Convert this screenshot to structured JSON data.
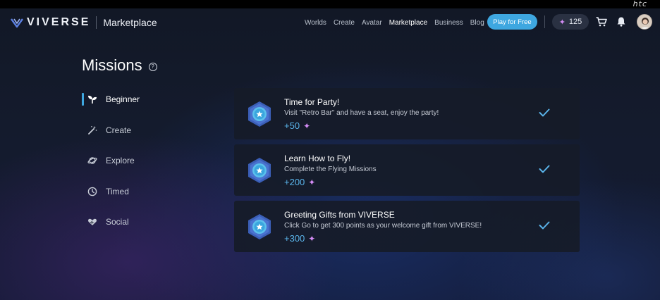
{
  "brand": {
    "name": "VIVERSE",
    "section": "Marketplace",
    "corner_logo": "htc"
  },
  "nav": [
    {
      "label": "Worlds",
      "active": false
    },
    {
      "label": "Create",
      "active": false
    },
    {
      "label": "Avatar",
      "active": false
    },
    {
      "label": "Marketplace",
      "active": true
    },
    {
      "label": "Business",
      "active": false
    },
    {
      "label": "Blog",
      "active": false
    }
  ],
  "header": {
    "play_label": "Play for Free",
    "points": "125",
    "icons": [
      "sparkle-icon",
      "cart-icon",
      "bell-icon",
      "avatar"
    ]
  },
  "page": {
    "title": "Missions",
    "help_glyph": "?"
  },
  "sidebar": {
    "items": [
      {
        "label": "Beginner",
        "icon": "sprout-icon",
        "active": true
      },
      {
        "label": "Create",
        "icon": "magic-wand-icon",
        "active": false
      },
      {
        "label": "Explore",
        "icon": "planet-icon",
        "active": false
      },
      {
        "label": "Timed",
        "icon": "clock-icon",
        "active": false
      },
      {
        "label": "Social",
        "icon": "handshake-heart-icon",
        "active": false
      }
    ]
  },
  "missions": [
    {
      "title": "Time for Party!",
      "description": "Visit \"Retro Bar\" and have a seat, enjoy the party!",
      "reward": "+50",
      "completed": true
    },
    {
      "title": "Learn How to Fly!",
      "description": "Complete the Flying Missions",
      "reward": "+200",
      "completed": true
    },
    {
      "title": "Greeting Gifts from VIVERSE",
      "description": "Click Go to get 300 points as your welcome gift from VIVERSE!",
      "reward": "+300",
      "completed": true
    }
  ],
  "colors": {
    "accent": "#3ea7e0",
    "sparkle": "#d48cf5",
    "reward_text": "#5ab4ea",
    "card_bg": "#161b28"
  }
}
